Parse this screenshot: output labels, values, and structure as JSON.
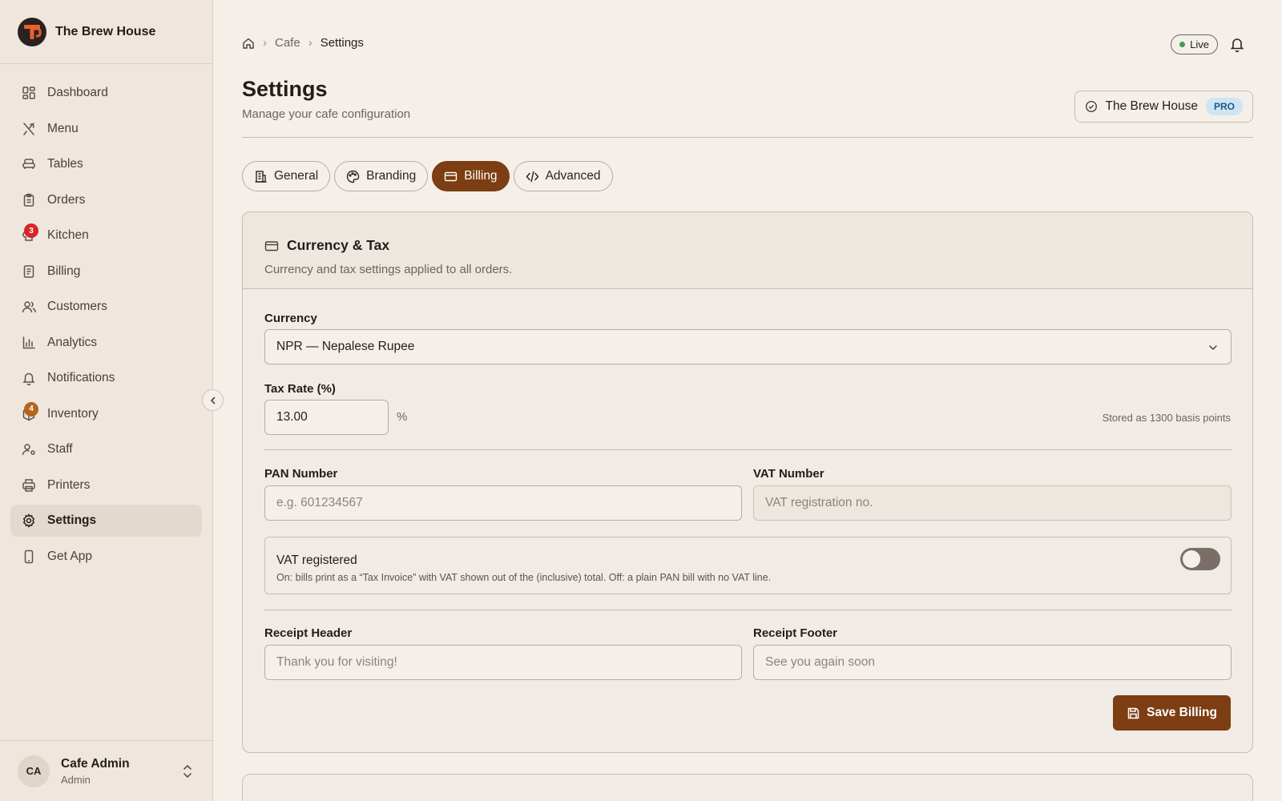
{
  "sidebar": {
    "brand": "The Brew House",
    "items": [
      {
        "label": "Dashboard",
        "icon": "dashboard-icon"
      },
      {
        "label": "Menu",
        "icon": "utensils-icon"
      },
      {
        "label": "Tables",
        "icon": "armchair-icon"
      },
      {
        "label": "Orders",
        "icon": "clipboard-icon"
      },
      {
        "label": "Kitchen",
        "icon": "chef-hat-icon",
        "badge": "3"
      },
      {
        "label": "Billing",
        "icon": "receipt-icon"
      },
      {
        "label": "Customers",
        "icon": "users-icon"
      },
      {
        "label": "Analytics",
        "icon": "bar-chart-icon"
      },
      {
        "label": "Notifications",
        "icon": "bell-icon"
      },
      {
        "label": "Inventory",
        "icon": "package-icon",
        "badge": "4"
      },
      {
        "label": "Staff",
        "icon": "user-cog-icon"
      },
      {
        "label": "Printers",
        "icon": "printer-icon"
      },
      {
        "label": "Settings",
        "icon": "gear-icon",
        "active": true
      },
      {
        "label": "Get App",
        "icon": "smartphone-icon"
      }
    ],
    "user": {
      "initials": "CA",
      "name": "Cafe Admin",
      "role": "Admin"
    }
  },
  "header": {
    "breadcrumb": [
      "Cafe",
      "Settings"
    ],
    "status": "Live",
    "title": "Settings",
    "subtitle": "Manage your cafe configuration",
    "org_name": "The Brew House",
    "plan": "PRO"
  },
  "tabs": [
    {
      "label": "General",
      "icon": "building-icon"
    },
    {
      "label": "Branding",
      "icon": "palette-icon"
    },
    {
      "label": "Billing",
      "icon": "credit-card-icon",
      "active": true
    },
    {
      "label": "Advanced",
      "icon": "code-icon"
    }
  ],
  "card": {
    "title": "Currency & Tax",
    "description": "Currency and tax settings applied to all orders.",
    "currency_label": "Currency",
    "currency_value": "NPR — Nepalese Rupee",
    "tax_label": "Tax Rate (%)",
    "tax_value": "13.00",
    "tax_unit": "%",
    "tax_hint": "Stored as 1300 basis points",
    "pan_label": "PAN Number",
    "pan_placeholder": "e.g. 601234567",
    "vat_label": "VAT Number",
    "vat_placeholder": "VAT registration no.",
    "vat_registered_title": "VAT registered",
    "vat_registered_desc": "On: bills print as a “Tax Invoice” with VAT shown out of the (inclusive) total. Off: a plain PAN bill with no VAT line.",
    "vat_registered_on": false,
    "receipt_header_label": "Receipt Header",
    "receipt_header_placeholder": "Thank you for visiting!",
    "receipt_footer_label": "Receipt Footer",
    "receipt_footer_placeholder": "See you again soon",
    "save_label": "Save Billing"
  },
  "colors": {
    "accent": "#7c3e12",
    "badge_red": "#d6262a",
    "badge_brown": "#b4661f",
    "live_dot": "#3aa055"
  }
}
